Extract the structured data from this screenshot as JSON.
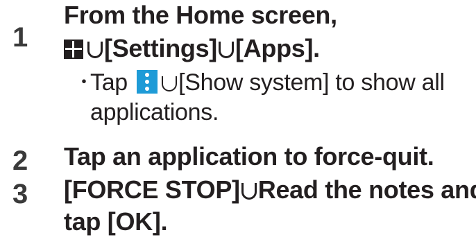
{
  "steps": [
    {
      "number": "1",
      "line1": "From the Home screen,",
      "settings": "[Settings]",
      "apps": "[Apps].",
      "note_bullet": "・",
      "note_tap": "Tap",
      "note_action": "[Show system] to show all",
      "note_line2": "applications."
    },
    {
      "number": "2",
      "text": "Tap an application to force-quit."
    },
    {
      "number": "3",
      "force_stop": "[FORCE STOP]",
      "text_a": "Read the notes and",
      "text_b": "tap [OK]."
    }
  ],
  "icons": {
    "apps_icon": "apps-grid",
    "more_icon": "more-options-vertical",
    "more_icon_color": "#1e9bd7",
    "arrow_icon": "arrow-then"
  }
}
